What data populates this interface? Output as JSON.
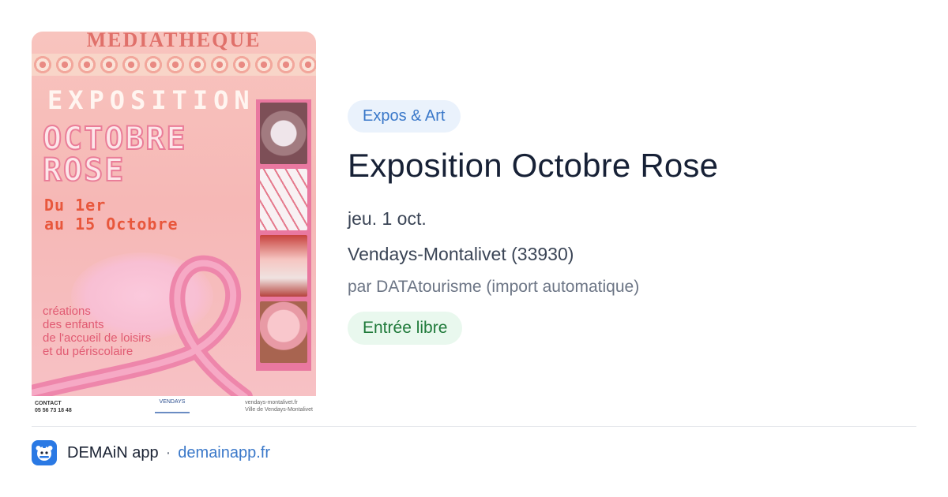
{
  "poster": {
    "header": "MEDIATHEQUE",
    "exposition": "EXPOSITION",
    "title_line1": "OCTOBRE",
    "title_line2": "ROSE",
    "dates_line1": "Du 1er",
    "dates_line2": "au 15 Octobre",
    "creations": [
      "créations",
      "des enfants",
      "de l'accueil de loisirs",
      "et du périscolaire"
    ],
    "contact_label": "CONTACT",
    "contact_phone": "05 56 73 18 48",
    "logo_text": "VENDAYS",
    "web": "vendays-montalivet.fr",
    "facebook": "Ville de Vendays-Montalivet"
  },
  "event": {
    "category": "Expos & Art",
    "title": "Exposition Octobre Rose",
    "date": "jeu. 1 oct.",
    "location": "Vendays-Montalivet (33930)",
    "organizer": "par DATAtourisme (import automatique)",
    "price": "Entrée libre"
  },
  "footer": {
    "app_name": "DEMAiN app",
    "separator": "·",
    "domain": "demainapp.fr"
  },
  "colors": {
    "accent": "#3a78c9",
    "tag_bg": "#eaf2fc",
    "price_fg": "#1f7a3a",
    "price_bg": "#e9f8ee",
    "poster_pink": "#f6b8b6"
  },
  "icons": {
    "app_icon": "demain-app-icon"
  }
}
